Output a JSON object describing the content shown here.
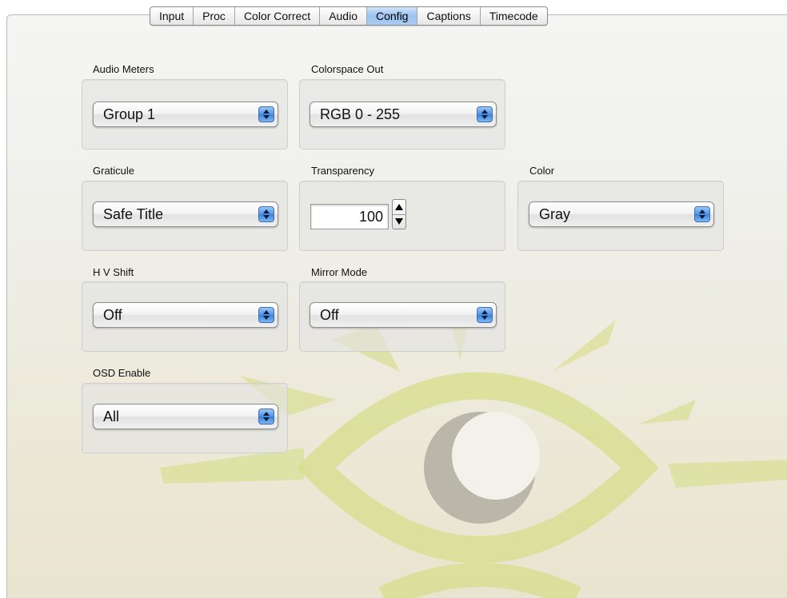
{
  "tabs": [
    {
      "label": "Input"
    },
    {
      "label": "Proc"
    },
    {
      "label": "Color Correct"
    },
    {
      "label": "Audio"
    },
    {
      "label": "Config",
      "active": true
    },
    {
      "label": "Captions"
    },
    {
      "label": "Timecode"
    }
  ],
  "settings": {
    "audio_meters": {
      "label": "Audio Meters",
      "value": "Group 1"
    },
    "colorspace_out": {
      "label": "Colorspace Out",
      "value": "RGB 0 - 255"
    },
    "graticule": {
      "label": "Graticule",
      "value": "Safe Title"
    },
    "transparency": {
      "label": "Transparency",
      "value": "100"
    },
    "color": {
      "label": "Color",
      "value": "Gray"
    },
    "hv_shift": {
      "label": "H V Shift",
      "value": "Off"
    },
    "mirror_mode": {
      "label": "Mirror Mode",
      "value": "Off"
    },
    "osd_enable": {
      "label": "OSD Enable",
      "value": "All"
    }
  },
  "colors": {
    "active_tab": "#9cc3f0",
    "popup_arrow": "#4f93e6",
    "watermark_green": "#d6df8e",
    "watermark_gray": "#b0aca0"
  },
  "icons": {
    "popup_arrows": "up-down-chevron-icon",
    "stepper": "stepper-arrows-icon",
    "watermark": "eye-logo-icon"
  }
}
